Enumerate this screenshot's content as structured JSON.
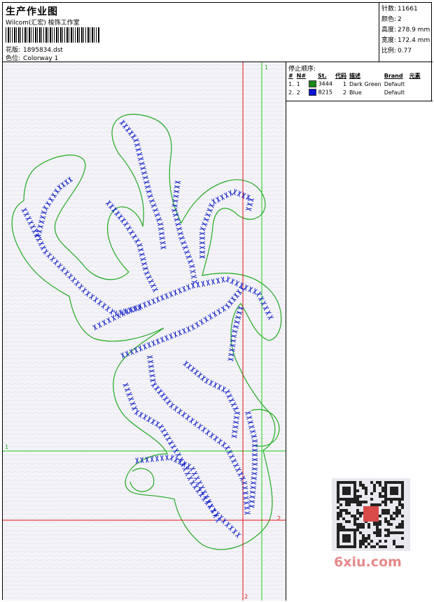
{
  "header": {
    "title": "生产作业图",
    "company": "Wilcom(汇宏) 梭饰工作室",
    "design_label": "花版:",
    "design_file": "1895834.dst",
    "colorway_label": "色位:",
    "colorway": "Colorway 1"
  },
  "stats": [
    {
      "label": "针数:",
      "value": "11661"
    },
    {
      "label": "颜色:",
      "value": "2"
    },
    {
      "label": "高度:",
      "value": "278.9 mm"
    },
    {
      "label": "宽度:",
      "value": "172.4 mm"
    },
    {
      "label": "比例:",
      "value": "0.77"
    }
  ],
  "stop_sequence": {
    "title": "停止顺序:",
    "columns": [
      "#",
      "N#",
      "St.",
      "代码",
      "描述",
      "Brand",
      "元素"
    ],
    "rows": [
      {
        "index": "1.",
        "n": "1",
        "color": "#1a8a1a",
        "stitches": "3444",
        "code": "1",
        "description": "Dark Green",
        "brand": "Default"
      },
      {
        "index": "2.",
        "n": "2",
        "color": "#0a14d6",
        "stitches": "8215",
        "code": "2",
        "description": "Blue",
        "brand": "Default"
      }
    ]
  },
  "guides": {
    "green_top": "1",
    "green_left": "1",
    "red_right": "2",
    "red_bottom": "2"
  },
  "colors": {
    "outline": "#22aa22",
    "stitch": "#1020c8",
    "guide_green": "#22cc22",
    "guide_red": "#e01010"
  },
  "watermark": "6xiu.com"
}
